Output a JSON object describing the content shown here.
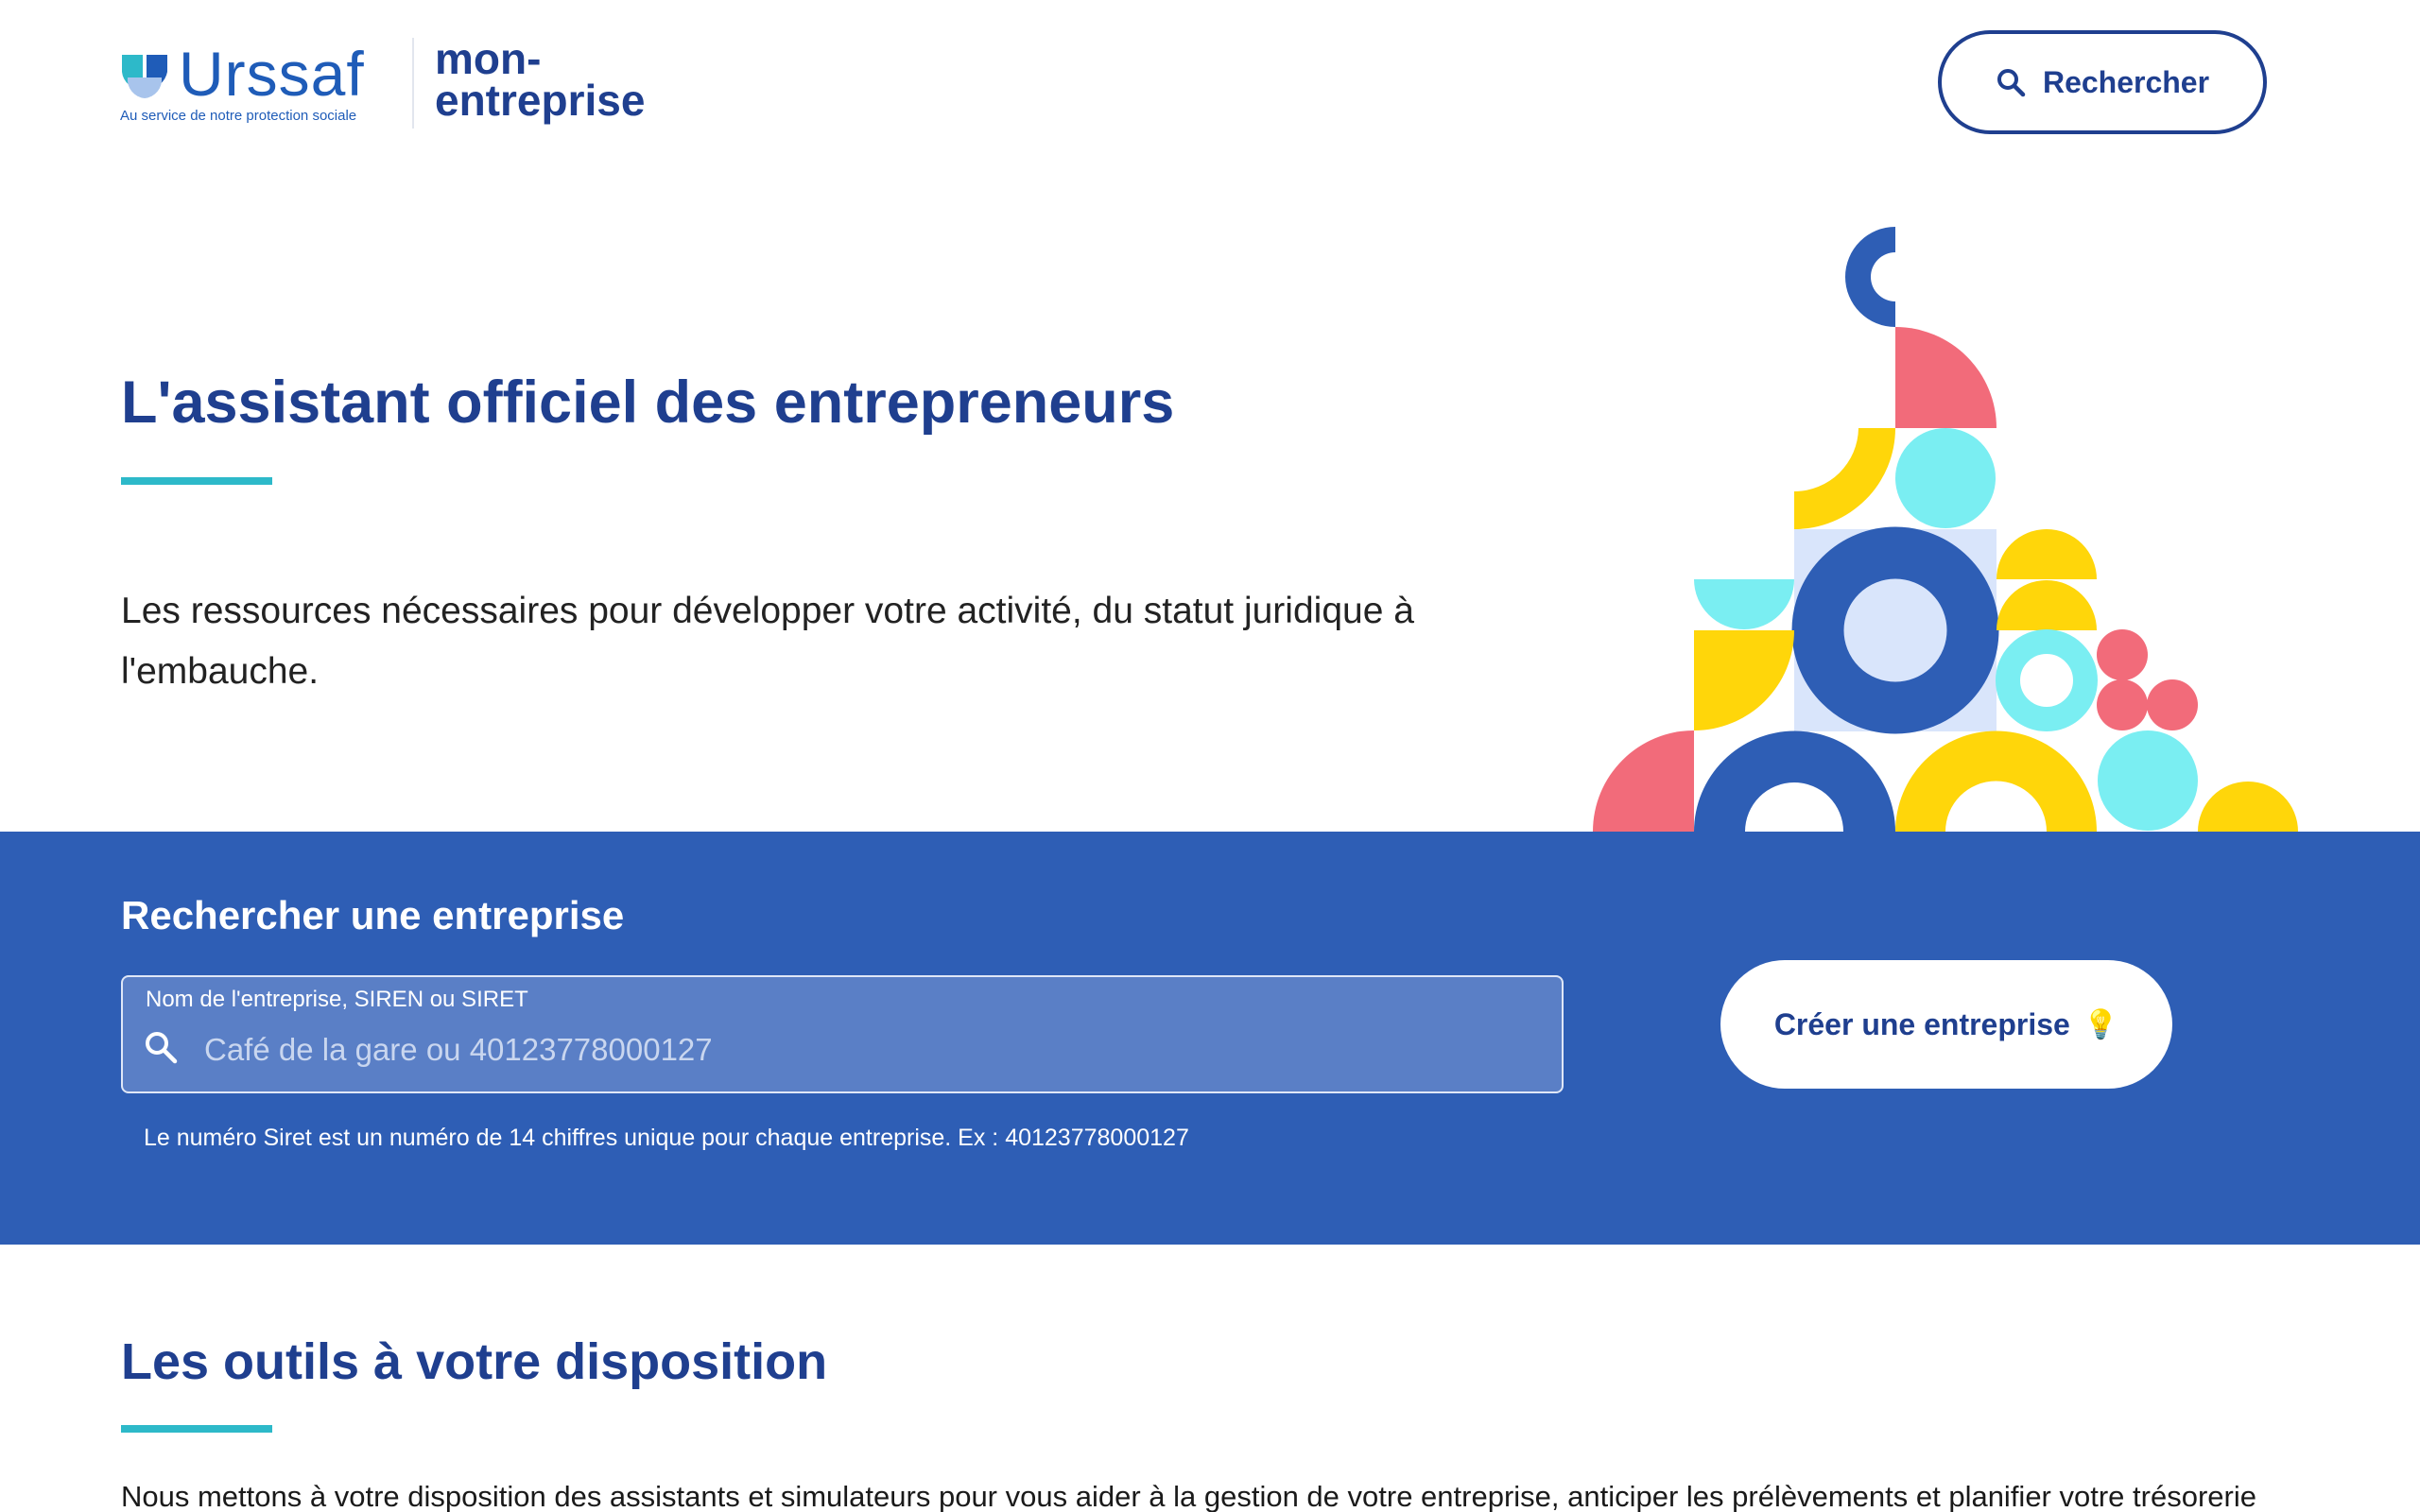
{
  "header": {
    "logo_wordmark": "Urssaf",
    "logo_tagline": "Au service de notre protection sociale",
    "site_name_line1": "mon-",
    "site_name_line2": "entreprise",
    "search_button_label": "Rechercher"
  },
  "hero": {
    "title": "L'assistant officiel des entrepreneurs",
    "subtitle": "Les ressources nécessaires pour développer votre activité, du statut juridique à l'embauche."
  },
  "company_search": {
    "title": "Rechercher une entreprise",
    "field_label": "Nom de l'entreprise, SIREN ou SIRET",
    "placeholder": "Café de la gare ou 40123778000127",
    "value": "",
    "help_text": "Le numéro Siret est un numéro de 14 chiffres unique pour chaque entreprise. Ex : 40123778000127",
    "create_button_label": "Créer une entreprise",
    "create_button_emoji": "💡"
  },
  "tools": {
    "title": "Les outils à votre disposition",
    "intro": "Nous mettons à votre disposition des assistants et simulateurs pour vous aider à la gestion de votre entreprise, anticiper les prélèvements et planifier votre trésorerie"
  },
  "colors": {
    "brand_dark": "#1f3f8f",
    "brand_blue": "#2e5eb5",
    "accent_teal": "#2db9c9",
    "shape_red": "#f26b7a",
    "shape_yellow": "#ffd60a",
    "shape_cyan": "#7aeef2",
    "shape_blue": "#2e5eb5"
  }
}
